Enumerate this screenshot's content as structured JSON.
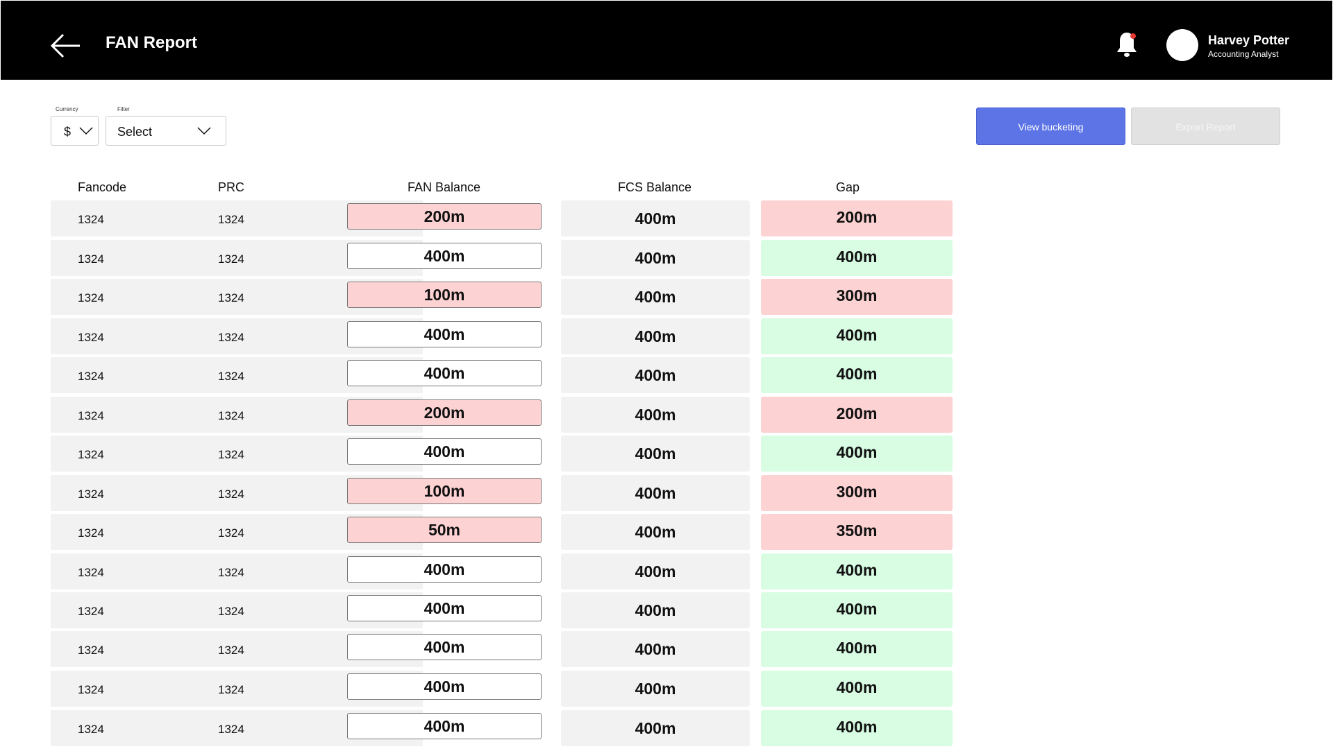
{
  "header": {
    "title": "FAN Report",
    "user": {
      "name": "Harvey Potter",
      "role": "Accounting Analyst"
    },
    "notification_dot_color": "#e53935"
  },
  "filters": {
    "currency": {
      "label": "Currency",
      "value": "$"
    },
    "filter": {
      "label": "Filter",
      "value": "Select"
    }
  },
  "actions": {
    "view_bucketing": "View bucketing",
    "export_report": "Export Report"
  },
  "table": {
    "columns": [
      "Fancode",
      "PRC",
      "FAN Balance",
      "FCS Balance",
      "Gap"
    ],
    "status_colors": {
      "mismatch": "#fdd2d3",
      "match": "#d8fde3"
    },
    "rows": [
      {
        "fancode": "1324",
        "prc": "1324",
        "fan_balance": "200m",
        "fcs_balance": "400m",
        "gap": "200m",
        "status": "mismatch"
      },
      {
        "fancode": "1324",
        "prc": "1324",
        "fan_balance": "400m",
        "fcs_balance": "400m",
        "gap": "400m",
        "status": "match"
      },
      {
        "fancode": "1324",
        "prc": "1324",
        "fan_balance": "100m",
        "fcs_balance": "400m",
        "gap": "300m",
        "status": "mismatch"
      },
      {
        "fancode": "1324",
        "prc": "1324",
        "fan_balance": "400m",
        "fcs_balance": "400m",
        "gap": "400m",
        "status": "match"
      },
      {
        "fancode": "1324",
        "prc": "1324",
        "fan_balance": "400m",
        "fcs_balance": "400m",
        "gap": "400m",
        "status": "match"
      },
      {
        "fancode": "1324",
        "prc": "1324",
        "fan_balance": "200m",
        "fcs_balance": "400m",
        "gap": "200m",
        "status": "mismatch"
      },
      {
        "fancode": "1324",
        "prc": "1324",
        "fan_balance": "400m",
        "fcs_balance": "400m",
        "gap": "400m",
        "status": "match"
      },
      {
        "fancode": "1324",
        "prc": "1324",
        "fan_balance": "100m",
        "fcs_balance": "400m",
        "gap": "300m",
        "status": "mismatch"
      },
      {
        "fancode": "1324",
        "prc": "1324",
        "fan_balance": "50m",
        "fcs_balance": "400m",
        "gap": "350m",
        "status": "mismatch"
      },
      {
        "fancode": "1324",
        "prc": "1324",
        "fan_balance": "400m",
        "fcs_balance": "400m",
        "gap": "400m",
        "status": "match"
      },
      {
        "fancode": "1324",
        "prc": "1324",
        "fan_balance": "400m",
        "fcs_balance": "400m",
        "gap": "400m",
        "status": "match"
      },
      {
        "fancode": "1324",
        "prc": "1324",
        "fan_balance": "400m",
        "fcs_balance": "400m",
        "gap": "400m",
        "status": "match"
      },
      {
        "fancode": "1324",
        "prc": "1324",
        "fan_balance": "400m",
        "fcs_balance": "400m",
        "gap": "400m",
        "status": "match"
      },
      {
        "fancode": "1324",
        "prc": "1324",
        "fan_balance": "400m",
        "fcs_balance": "400m",
        "gap": "400m",
        "status": "match"
      }
    ]
  }
}
